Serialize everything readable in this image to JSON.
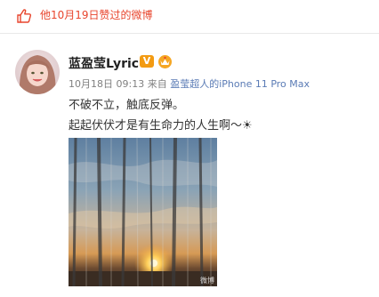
{
  "header": {
    "like_text": "他10月19日赞过的微博"
  },
  "post": {
    "username": "蓝盈莹Lyric",
    "verified_badge": "V",
    "timestamp": "10月18日 09:13",
    "from_label": "来自",
    "device": "盈莹超人的iPhone 11 Pro Max",
    "content_line1": "不破不立，触底反弹。",
    "content_line2": "起起伏伏才是有生命力的人生啊～☀",
    "image_watermark": "微博"
  },
  "colors": {
    "like_accent": "#e8452d",
    "verified_badge": "#f39b12",
    "device_link": "#5a7bb5"
  }
}
